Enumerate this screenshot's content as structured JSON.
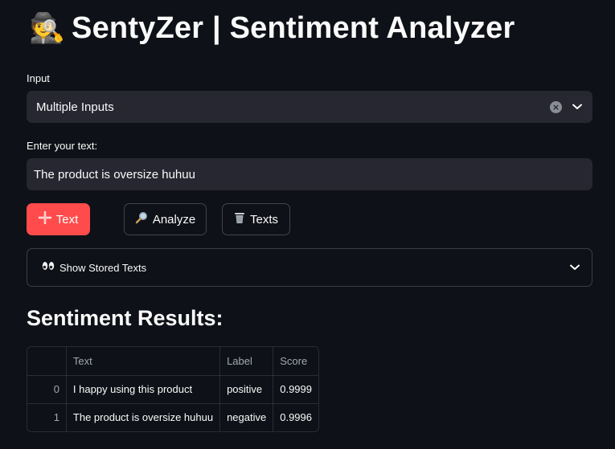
{
  "app": {
    "title_icon": "detective-emoji",
    "title": "SentyZer | Sentiment Analyzer"
  },
  "input_select": {
    "label": "Input",
    "value": "Multiple Inputs"
  },
  "text_input": {
    "label": "Enter your text:",
    "value": "The product is oversize huhuu"
  },
  "buttons": {
    "add_text_label": "Text",
    "add_text_icon": "plus-icon",
    "analyze_label": "Analyze",
    "analyze_icon": "magnifier-icon",
    "clear_texts_label": "Texts",
    "clear_texts_icon": "trash-icon"
  },
  "expander": {
    "label": "Show Stored Texts",
    "icon": "eyes-icon"
  },
  "results": {
    "title": "Sentiment Results:",
    "columns": [
      "",
      "Text",
      "Label",
      "Score"
    ],
    "rows": [
      {
        "index": "0",
        "text": "I happy using this product",
        "label": "positive",
        "score": "0.9999"
      },
      {
        "index": "1",
        "text": "The product is oversize huhuu",
        "label": "negative",
        "score": "0.9996"
      }
    ]
  },
  "colors": {
    "background": "#0e1117",
    "primary": "#ff4b4b",
    "widget": "#262730"
  }
}
